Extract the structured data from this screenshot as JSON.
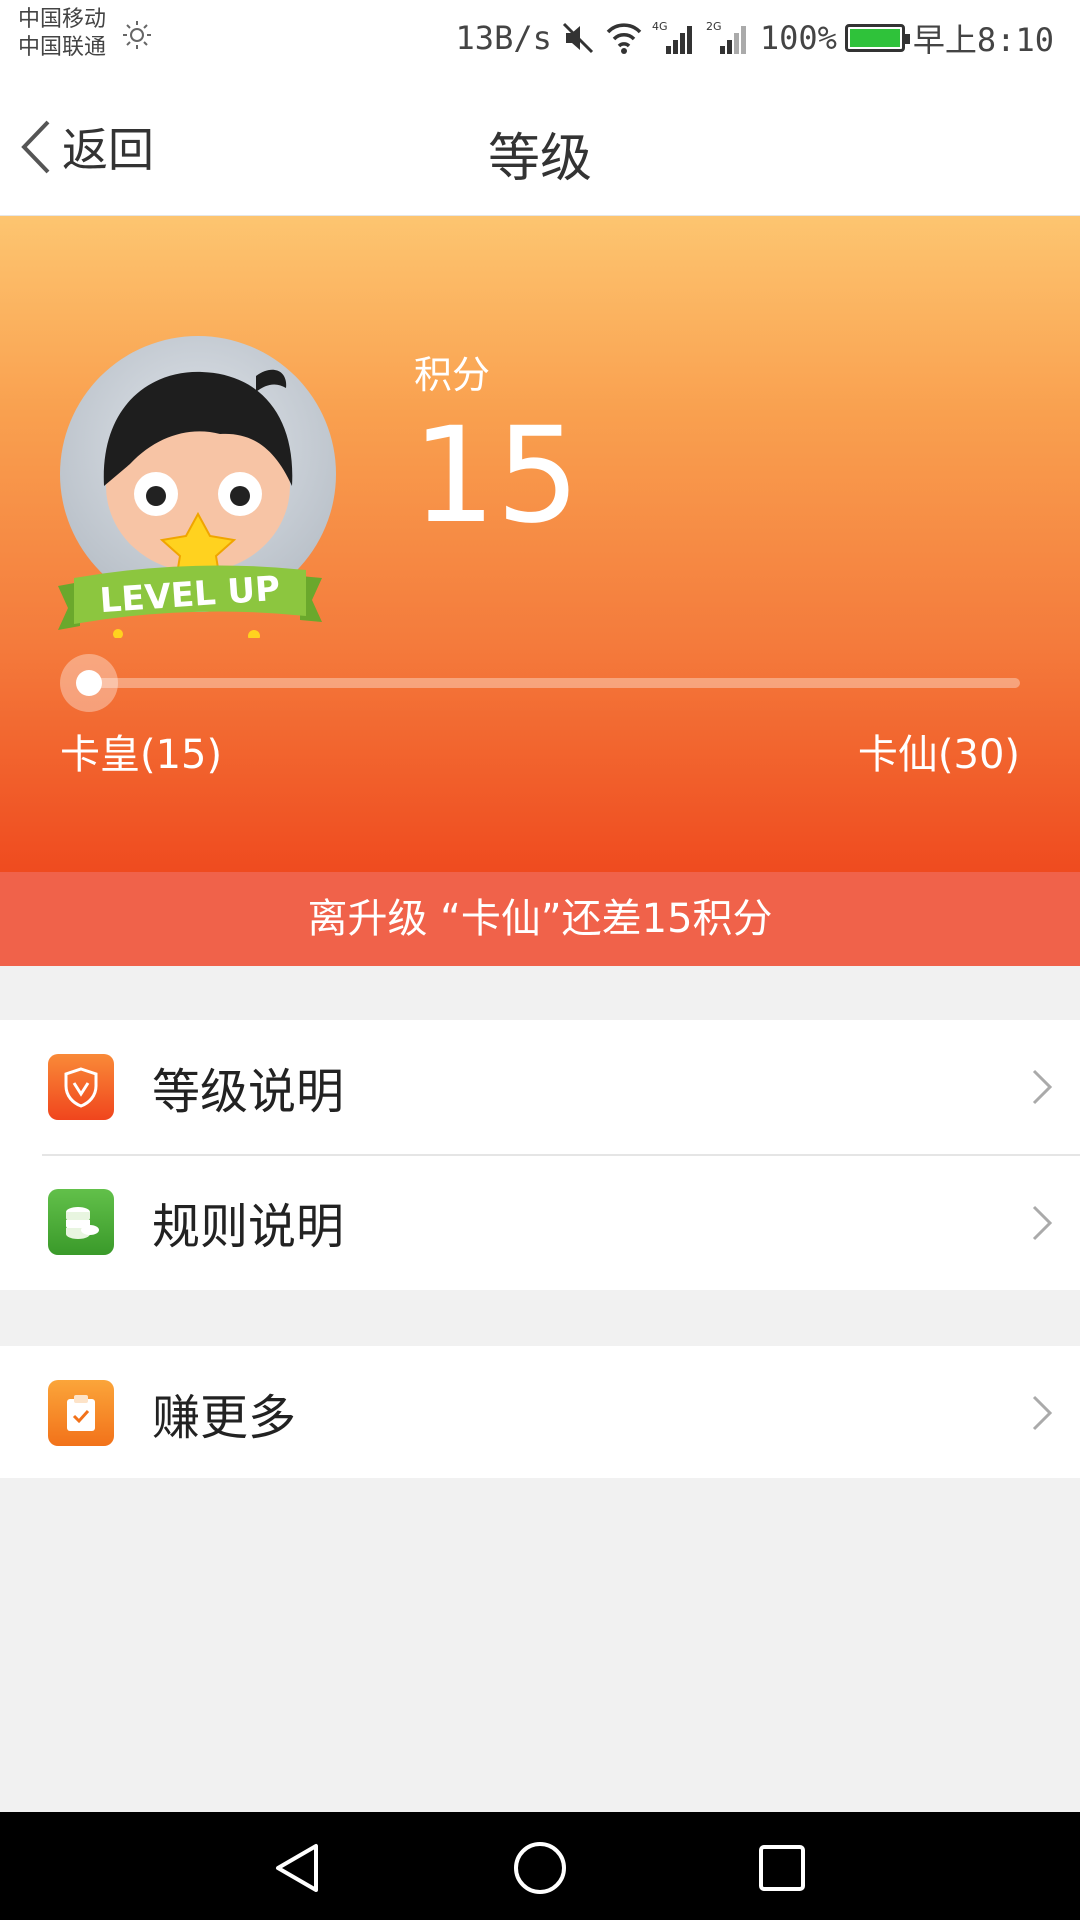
{
  "status_bar": {
    "carrier_1": "中国移动",
    "carrier_2": "中国联通",
    "net_speed": "13B/s",
    "battery": "100%",
    "time": "早上8:10"
  },
  "nav": {
    "back_label": "返回",
    "title": "等级"
  },
  "hero": {
    "points_label": "积分",
    "points_value": "15",
    "badge_text": "LEVEL UP",
    "current_level": "卡皇(15)",
    "next_level": "卡仙(30)",
    "progress_fraction": 0.0
  },
  "banner": {
    "text": "离升级 “卡仙”还差15积分"
  },
  "menu": {
    "items": [
      {
        "label": "等级说明",
        "icon": "shield-icon",
        "color": "#f4562a"
      },
      {
        "label": "规则说明",
        "icon": "coins-icon",
        "color": "#4cae3a"
      },
      {
        "label": "赚更多",
        "icon": "clipboard-icon",
        "color": "#f78a21"
      }
    ]
  },
  "colors": {
    "hero_top": "#fdc570",
    "hero_bottom": "#ef4b1f",
    "banner": "#f0624a"
  }
}
